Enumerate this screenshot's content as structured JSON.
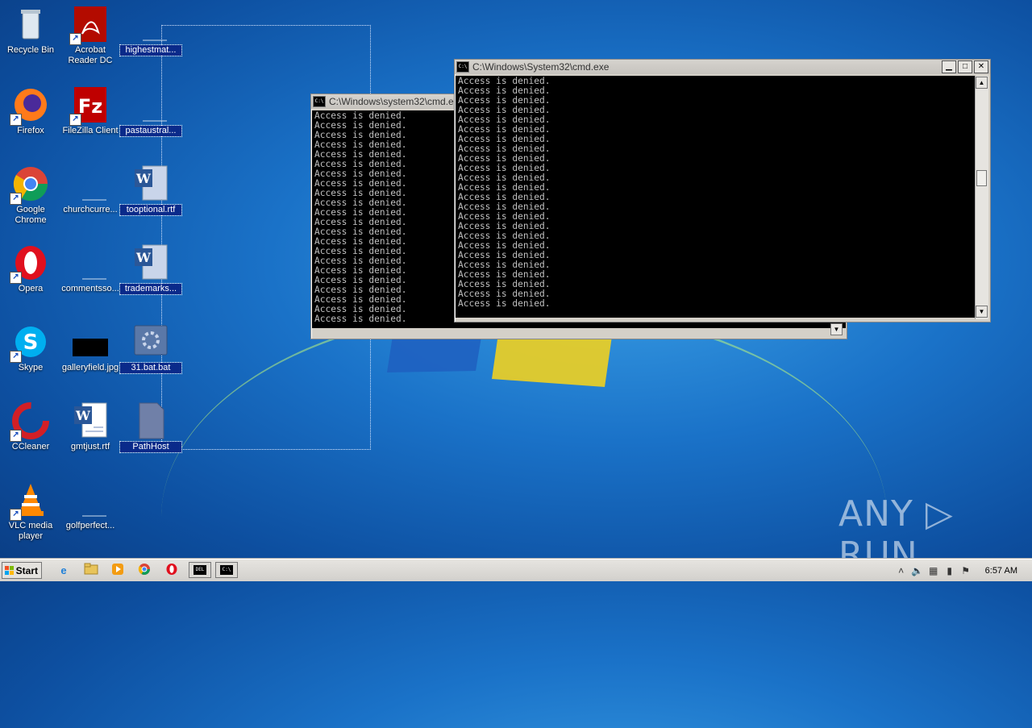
{
  "desktop": {
    "icons": [
      {
        "id": "recycle-bin",
        "label": "Recycle Bin"
      },
      {
        "id": "acrobat",
        "label": "Acrobat Reader DC"
      },
      {
        "id": "highestmat",
        "label": "highestmat..."
      },
      {
        "id": "firefox",
        "label": "Firefox"
      },
      {
        "id": "filezilla",
        "label": "FileZilla Client"
      },
      {
        "id": "pastaustral",
        "label": "pastaustral..."
      },
      {
        "id": "chrome",
        "label": "Google Chrome"
      },
      {
        "id": "churchcurre",
        "label": "churchcurre..."
      },
      {
        "id": "tooptional",
        "label": "tooptional.rtf"
      },
      {
        "id": "opera",
        "label": "Opera"
      },
      {
        "id": "commentsso",
        "label": "commentsso..."
      },
      {
        "id": "trademarks",
        "label": "trademarks..."
      },
      {
        "id": "skype",
        "label": "Skype"
      },
      {
        "id": "galleryfield",
        "label": "galleryfield.jpg"
      },
      {
        "id": "bat31",
        "label": "31.bat.bat"
      },
      {
        "id": "ccleaner",
        "label": "CCleaner"
      },
      {
        "id": "gmtjust",
        "label": "gmtjust.rtf"
      },
      {
        "id": "pathhost",
        "label": "PathHost"
      },
      {
        "id": "vlc",
        "label": "VLC media player"
      },
      {
        "id": "golfperfect",
        "label": "golfperfect..."
      }
    ]
  },
  "windows": {
    "back": {
      "title": "C:\\Windows\\system32\\cmd.exe",
      "lines": [
        "Access is denied.",
        "Access is denied.",
        "Access is denied.",
        "Access is denied.",
        "Access is denied.",
        "Access is denied.",
        "Access is denied.",
        "Access is denied.",
        "Access is denied.",
        "Access is denied.",
        "Access is denied.",
        "Access is denied.",
        "Access is denied.",
        "Access is denied.",
        "Access is denied.",
        "Access is denied.",
        "Access is denied.",
        "Access is denied.",
        "Access is denied.",
        "Access is denied.",
        "Access is denied.",
        "Access is denied."
      ]
    },
    "front": {
      "title": "C:\\Windows\\System32\\cmd.exe",
      "lines": [
        "Access is denied.",
        "Access is denied.",
        "Access is denied.",
        "Access is denied.",
        "Access is denied.",
        "Access is denied.",
        "Access is denied.",
        "Access is denied.",
        "Access is denied.",
        "Access is denied.",
        "Access is denied.",
        "Access is denied.",
        "Access is denied.",
        "Access is denied.",
        "Access is denied.",
        "Access is denied.",
        "Access is denied.",
        "Access is denied.",
        "Access is denied.",
        "Access is denied.",
        "Access is denied.",
        "Access is denied.",
        "Access is denied.",
        "Access is denied."
      ]
    }
  },
  "taskbar": {
    "start_label": "Start",
    "pinned": [
      "ie-icon",
      "explorer-icon",
      "media-player-icon",
      "chrome-icon",
      "opera-icon"
    ],
    "tasks": [
      {
        "glyph": "DEL"
      },
      {
        "glyph": "C:\\"
      }
    ],
    "clock": "6:57 AM"
  },
  "watermark": "ANY ▷ RUN"
}
